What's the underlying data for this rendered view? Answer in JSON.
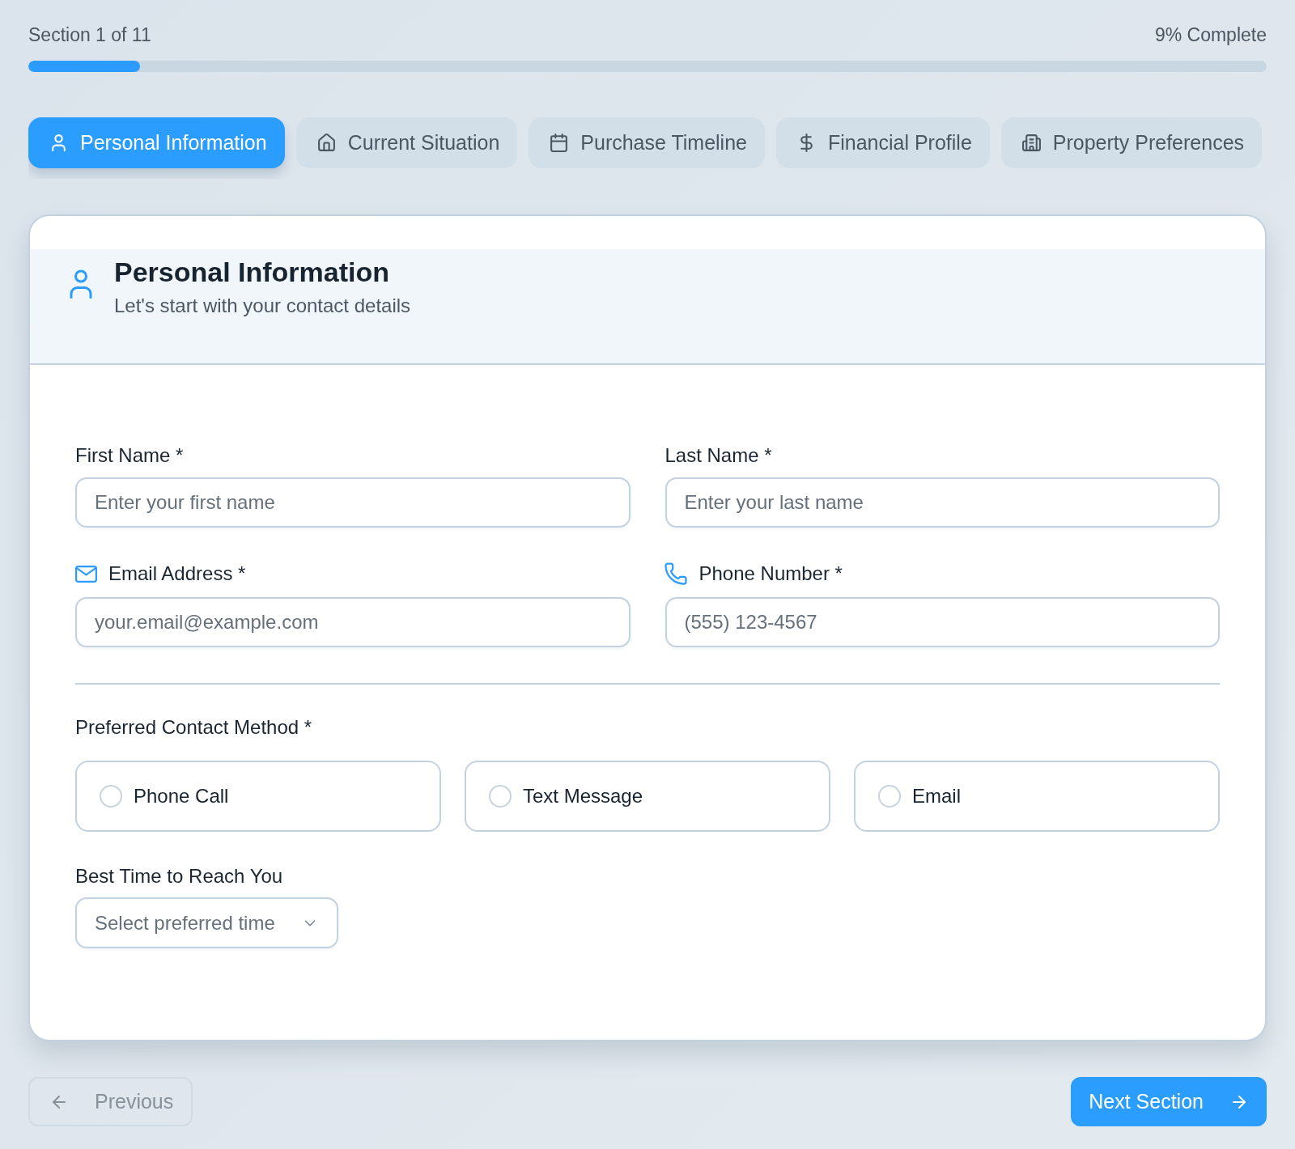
{
  "progress": {
    "section_label": "Section 1 of 11",
    "percent_label": "9% Complete",
    "level": 0.09
  },
  "tabs": [
    {
      "label": "Personal Information",
      "selected": true
    },
    {
      "label": "Current Situation",
      "selected": false
    },
    {
      "label": "Purchase Timeline",
      "selected": false
    },
    {
      "label": "Financial Profile",
      "selected": false
    },
    {
      "label": "Property Preferences",
      "selected": false
    }
  ],
  "card": {
    "title": "Personal Information",
    "subtitle": "Let's start with your contact details",
    "fields": [
      {
        "kind": "text",
        "label": "First Name *",
        "placeholder": "Enter your first name"
      },
      {
        "kind": "text",
        "label": "Last Name *",
        "placeholder": "Enter your last name"
      },
      {
        "kind": "email",
        "label": "Email Address *",
        "placeholder": "your.email@example.com"
      },
      {
        "kind": "phone",
        "label": "Phone Number *",
        "placeholder": "(555) 123-4567"
      }
    ],
    "contact_method": {
      "label": "Preferred Contact Method *",
      "options": [
        {
          "label": "Phone Call",
          "selected": false
        },
        {
          "label": "Text Message",
          "selected": false
        },
        {
          "label": "Email",
          "selected": false
        }
      ]
    },
    "best_time": {
      "label": "Best Time to Reach You",
      "placeholder": "Select preferred time"
    }
  },
  "buttons": {
    "previous": {
      "label": "Previous",
      "disabled": true
    },
    "next": {
      "label": "Next Section"
    }
  }
}
